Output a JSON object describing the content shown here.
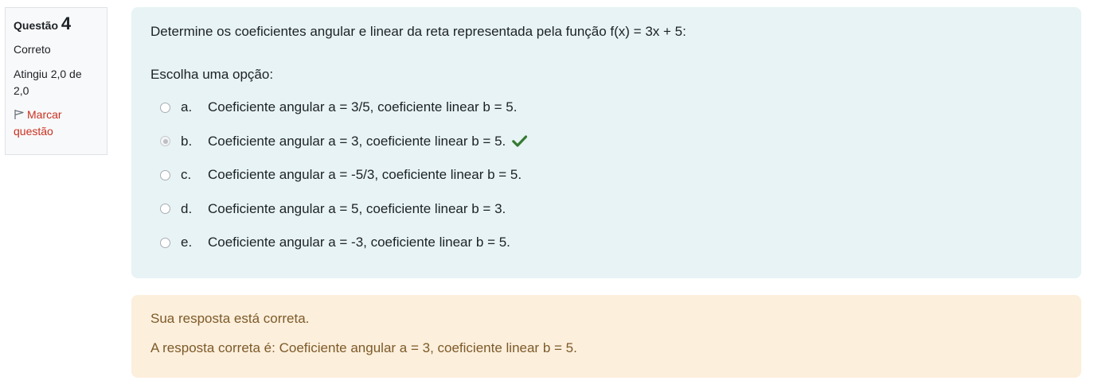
{
  "info": {
    "question_label": "Questão",
    "question_number": "4",
    "state": "Correto",
    "grade": "Atingiu 2,0 de 2,0",
    "flag_label": "Marcar questão",
    "flag_icon": "flag-outline-icon"
  },
  "question": {
    "text": "Determine os coeficientes angular e linear da reta representada pela função f(x) = 3x + 5:",
    "prompt": "Escolha uma opção:",
    "options": [
      {
        "letter": "a.",
        "text": "Coeficiente angular a = 3/5, coeficiente linear b = 5.",
        "selected": false
      },
      {
        "letter": "b.",
        "text": "Coeficiente angular a = 3, coeficiente linear b = 5.",
        "selected": true,
        "mark": "check-icon"
      },
      {
        "letter": "c.",
        "text": "Coeficiente angular a = -5/3, coeficiente linear b = 5.",
        "selected": false
      },
      {
        "letter": "d.",
        "text": "Coeficiente angular a = 5, coeficiente linear b = 3.",
        "selected": false
      },
      {
        "letter": "e.",
        "text": "Coeficiente angular a = -3, coeficiente linear b = 5.",
        "selected": false
      }
    ]
  },
  "outcome": {
    "feedback": "Sua resposta está correta.",
    "right_answer": "A resposta correta é: Coeficiente angular a = 3, coeficiente linear b = 5."
  },
  "colors": {
    "flag": "#ca3120",
    "check": "#357a32",
    "formulation_bg": "#e7f3f5",
    "outcome_bg": "#fcefdc",
    "outcome_text": "#7d5a29"
  }
}
